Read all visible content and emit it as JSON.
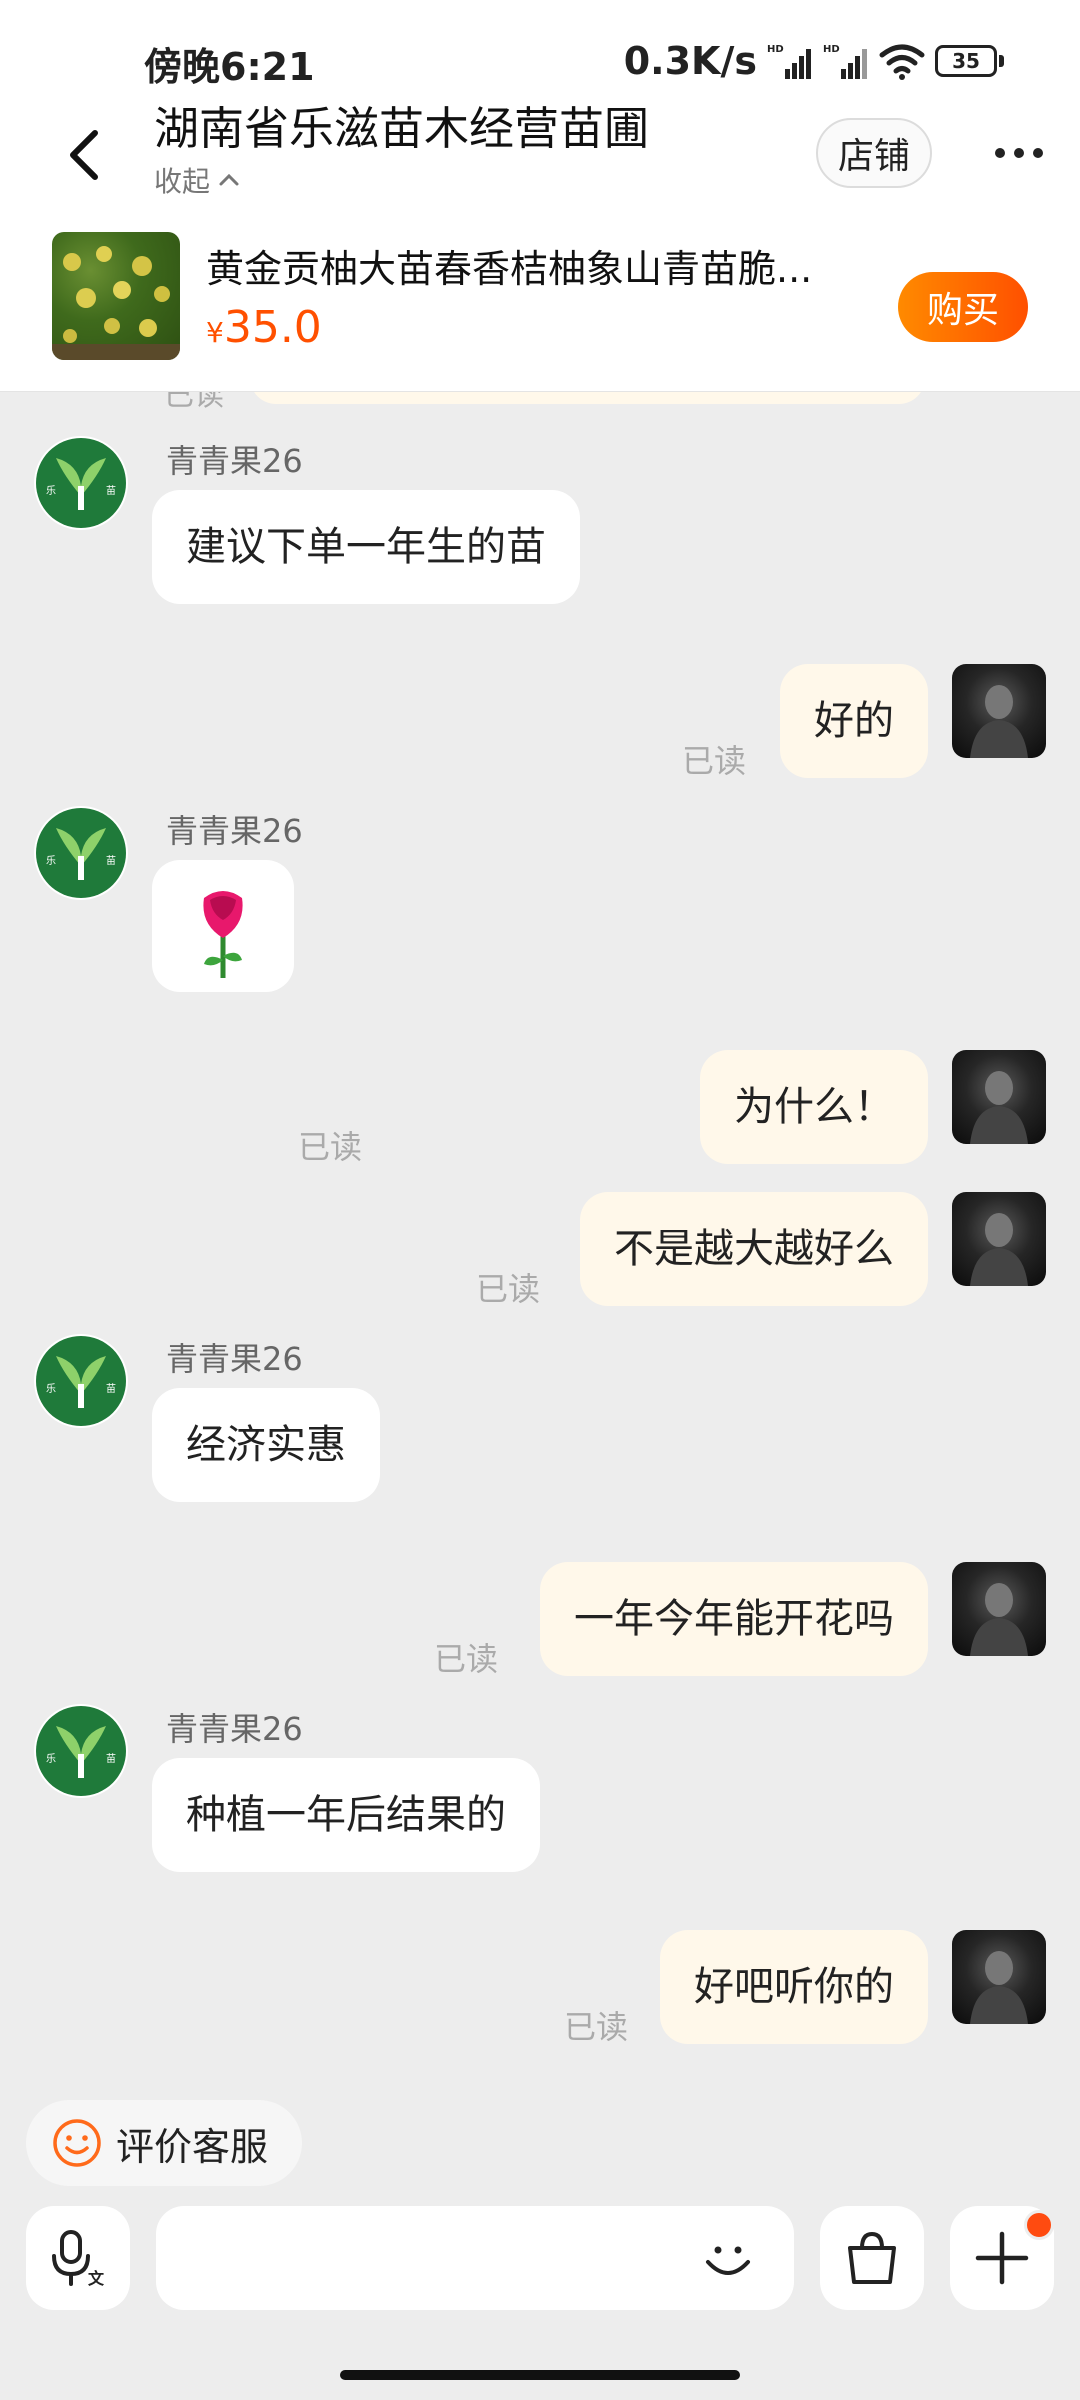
{
  "status_bar": {
    "time": "傍晚6:21",
    "net_speed": "0.3K/s",
    "battery": "35"
  },
  "header": {
    "shop_name": "湖南省乐滋苗木经营苗圃",
    "collapse_label": "收起",
    "store_button": "店铺",
    "product": {
      "name": "黄金贡柚大苗春香桔柚象山青苗脆...",
      "currency": "¥",
      "price": "35.0",
      "buy_button": "购买"
    }
  },
  "chat": {
    "read_label": "已读",
    "messages": [
      {
        "side": "left",
        "sender": "青青果26",
        "text": "建议下单一年生的苗"
      },
      {
        "side": "right",
        "text": "好的",
        "status": "已读"
      },
      {
        "side": "left",
        "sender": "青青果26",
        "text": "🌹"
      },
      {
        "side": "right",
        "text": "为什么！",
        "status": "已读"
      },
      {
        "side": "right",
        "text": "不是越大越好么",
        "status": "已读"
      },
      {
        "side": "left",
        "sender": "青青果26",
        "text": "经济实惠"
      },
      {
        "side": "right",
        "text": "一年今年能开花吗",
        "status": "已读"
      },
      {
        "side": "left",
        "sender": "青青果26",
        "text": "种植一年后结果的"
      },
      {
        "side": "right",
        "text": "好吧听你的",
        "status": "已读"
      }
    ]
  },
  "bottom": {
    "rate_label": "评价客服",
    "input_value": "",
    "input_placeholder": ""
  },
  "colors": {
    "accent": "#ff5000",
    "my_bubble": "#fff8ea",
    "background": "#ededed"
  },
  "icons": [
    "back-arrow-icon",
    "chevron-up-icon",
    "more-dots-icon",
    "smile-icon",
    "microphone-icon",
    "emoji-icon",
    "shopping-bag-icon",
    "plus-icon"
  ]
}
